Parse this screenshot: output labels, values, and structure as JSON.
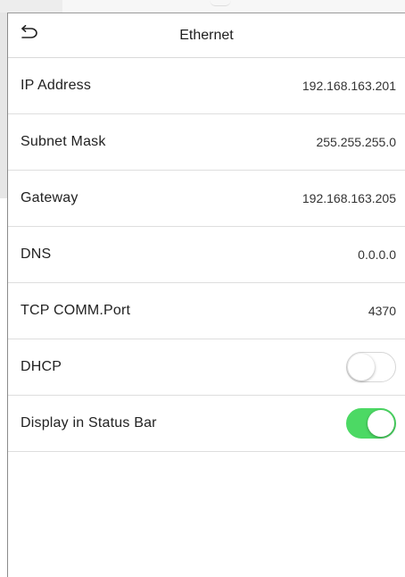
{
  "header": {
    "title": "Ethernet",
    "back_icon": "back-arrow-icon"
  },
  "rows": [
    {
      "label": "IP Address",
      "value": "192.168.163.201"
    },
    {
      "label": "Subnet Mask",
      "value": "255.255.255.0"
    },
    {
      "label": "Gateway",
      "value": "192.168.163.205"
    },
    {
      "label": "DNS",
      "value": "0.0.0.0"
    },
    {
      "label": "TCP COMM.Port",
      "value": "4370"
    }
  ],
  "toggles": [
    {
      "label": "DHCP",
      "state": "off"
    },
    {
      "label": "Display in Status Bar",
      "state": "on"
    }
  ],
  "colors": {
    "toggle_on": "#4cd964",
    "toggle_off_border": "#d6d6d6",
    "divider": "#dedede"
  }
}
